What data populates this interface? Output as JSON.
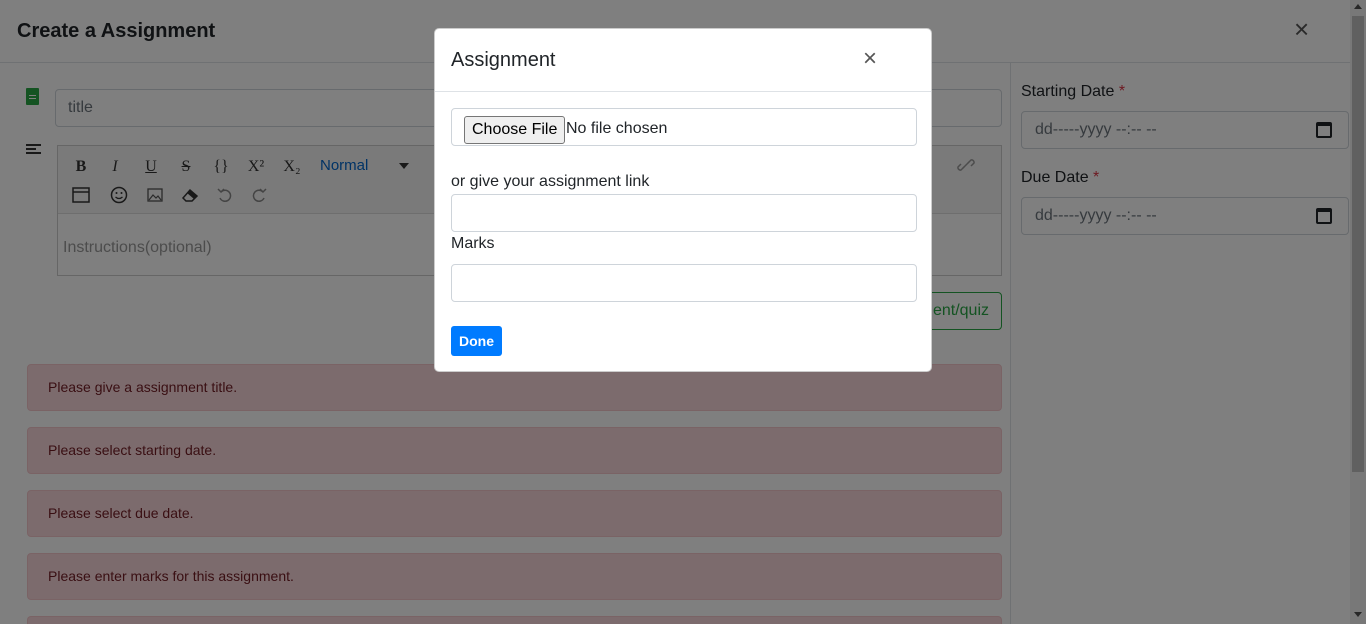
{
  "page": {
    "title": "Create a Assignment",
    "close_glyph": "×",
    "title_placeholder": "title",
    "instructions_placeholder": "Instructions(optional)",
    "quiz_button_label": "ent/quiz",
    "toolbar": {
      "bold": "B",
      "italic": "I",
      "underline": "U",
      "strike": "S",
      "code": "{}",
      "superscript": "X²",
      "subscript": "X₂",
      "format_select": "Normal"
    },
    "alerts": [
      "Please give a assignment title.",
      "Please select starting date.",
      "Please select due date.",
      "Please enter marks for this assignment."
    ],
    "starting_date": {
      "label": "Starting Date",
      "required_mark": "*",
      "placeholder": "dd-----yyyy --:-- --"
    },
    "due_date": {
      "label": "Due Date",
      "required_mark": "*",
      "placeholder": "dd-----yyyy --:-- --"
    }
  },
  "modal": {
    "title": "Assignment",
    "close_glyph": "×",
    "file_button_label": "Choose File",
    "file_status": "No file chosen",
    "link_label": "or give your assignment link",
    "link_value": "",
    "marks_label": "Marks",
    "marks_value": "",
    "done_label": "Done"
  },
  "colors": {
    "primary": "#007bff",
    "success": "#28a745",
    "alert_bg": "#f8d7da",
    "alert_text": "#721c24",
    "required": "#dc3545"
  }
}
